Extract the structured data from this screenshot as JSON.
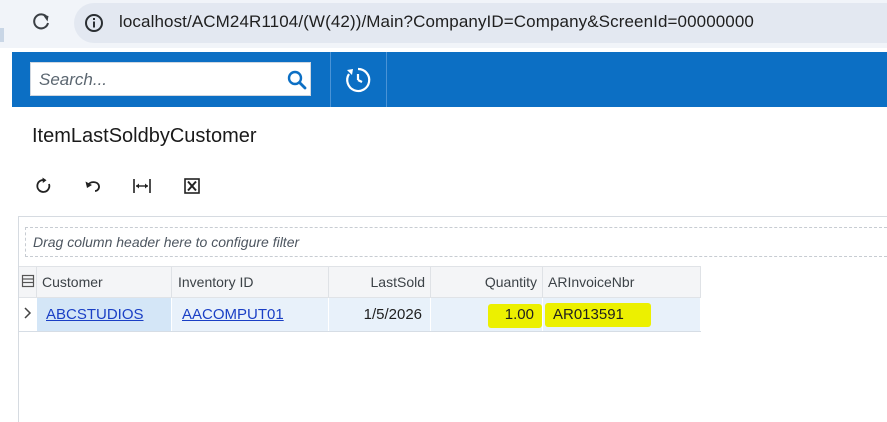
{
  "browser": {
    "url": "localhost/ACM24R1104/(W(42))/Main?CompanyID=Company&ScreenId=00000000",
    "reload_icon": "reload-icon",
    "info_icon": "site-info-icon"
  },
  "header": {
    "search_placeholder": "Search...",
    "search_icon": "search-icon",
    "history_icon": "clock-icon",
    "accent_color": "#0c6fc4"
  },
  "page": {
    "title": "ItemLastSoldbyCustomer"
  },
  "toolbar": {
    "buttons": [
      "refresh-icon",
      "undo-icon",
      "fit-columns-icon",
      "export-excel-icon"
    ]
  },
  "grid": {
    "filter_hint": "Drag column header here to configure filter",
    "columns": [
      "Customer",
      "Inventory ID",
      "LastSold",
      "Quantity",
      "ARInvoiceNbr"
    ],
    "rows": [
      {
        "customer": "ABCSTUDIOS",
        "inventory_id": "AACOMPUT01",
        "last_sold": "1/5/2026",
        "quantity": "1.00",
        "ar_invoice_nbr": "AR013591"
      }
    ],
    "highlight_color": "#ecf000"
  }
}
